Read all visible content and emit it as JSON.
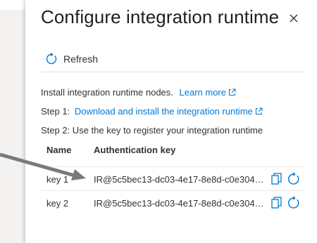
{
  "panel": {
    "title": "Configure integration runtime",
    "close_icon": "close-icon"
  },
  "toolbar": {
    "refresh_label": "Refresh",
    "refresh_icon": "refresh-icon"
  },
  "content": {
    "install_text": "Install integration runtime nodes.",
    "learn_more_label": "Learn more",
    "step1_prefix": "Step 1:",
    "step1_link": "Download and install the integration runtime",
    "step2_text": "Step 2: Use the key to register your integration runtime"
  },
  "table": {
    "columns": [
      "Name",
      "Authentication key"
    ],
    "rows": [
      {
        "name": "key 1",
        "key": "IR@5c5bec13-dc03-4e17-8e8d-c0e304a..."
      },
      {
        "name": "key 2",
        "key": "IR@5c5bec13-dc03-4e17-8e8d-c0e304a..."
      }
    ]
  },
  "colors": {
    "link": "#0078d4",
    "text": "#323130",
    "arrow": "#7a7a7a"
  }
}
